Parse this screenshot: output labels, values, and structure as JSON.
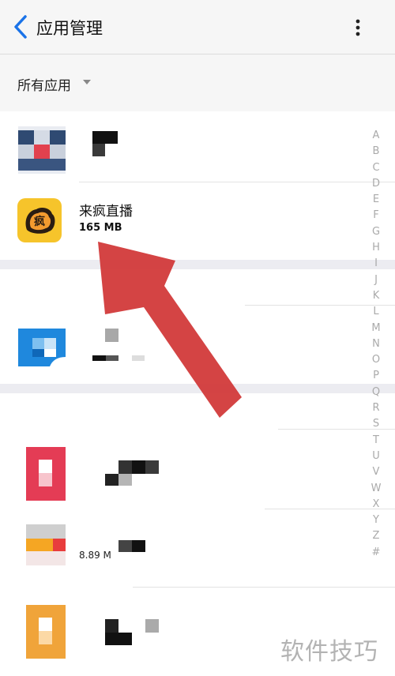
{
  "header": {
    "title": "应用管理"
  },
  "filter": {
    "label": "所有应用"
  },
  "apps": [
    {
      "name": "来疯直播",
      "size": "165 MB"
    }
  ],
  "partial_size": "8.89 M",
  "index_letters": [
    "A",
    "B",
    "C",
    "D",
    "E",
    "F",
    "G",
    "H",
    "I",
    "J",
    "K",
    "L",
    "M",
    "N",
    "O",
    "P",
    "Q",
    "R",
    "S",
    "T",
    "U",
    "V",
    "W",
    "X",
    "Y",
    "Z",
    "#"
  ],
  "watermark": "软件技巧",
  "colors": {
    "accent": "#1a73e8",
    "arrow": "#d23a3a",
    "header_bg": "#f6f6f6"
  }
}
